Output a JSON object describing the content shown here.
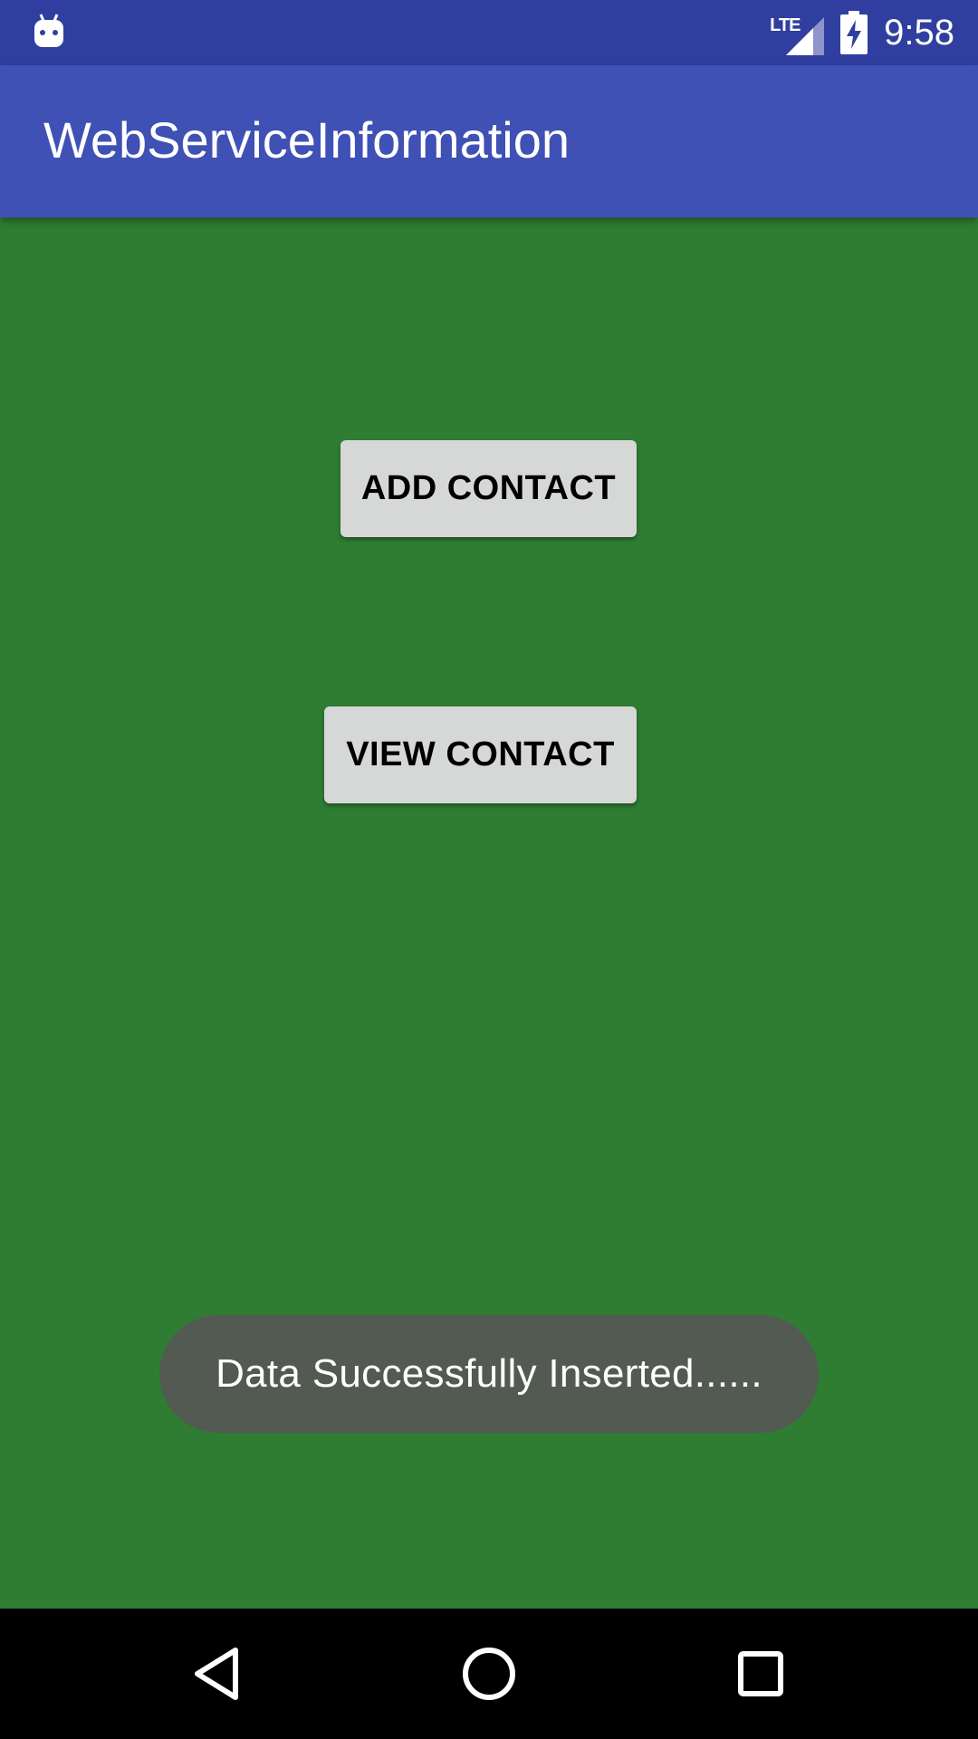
{
  "status_bar": {
    "network_label": "LTE",
    "time": "9:58",
    "icons": [
      "android-notification-icon",
      "signal-icon",
      "battery-charging-icon"
    ]
  },
  "app_bar": {
    "title": "WebServiceInformation"
  },
  "content": {
    "add_contact_label": "ADD CONTACT",
    "view_contact_label": "VIEW CONTACT"
  },
  "toast": {
    "message": "Data Successfully Inserted......"
  },
  "nav_bar": {
    "icons": [
      "back-icon",
      "home-icon",
      "recent-apps-icon"
    ]
  },
  "colors": {
    "status_bar": "#303f9f",
    "app_bar": "#3f51b5",
    "background": "#2f7d33",
    "button": "#d6d7d7",
    "toast": "#535a52",
    "nav_bar": "#000000"
  }
}
